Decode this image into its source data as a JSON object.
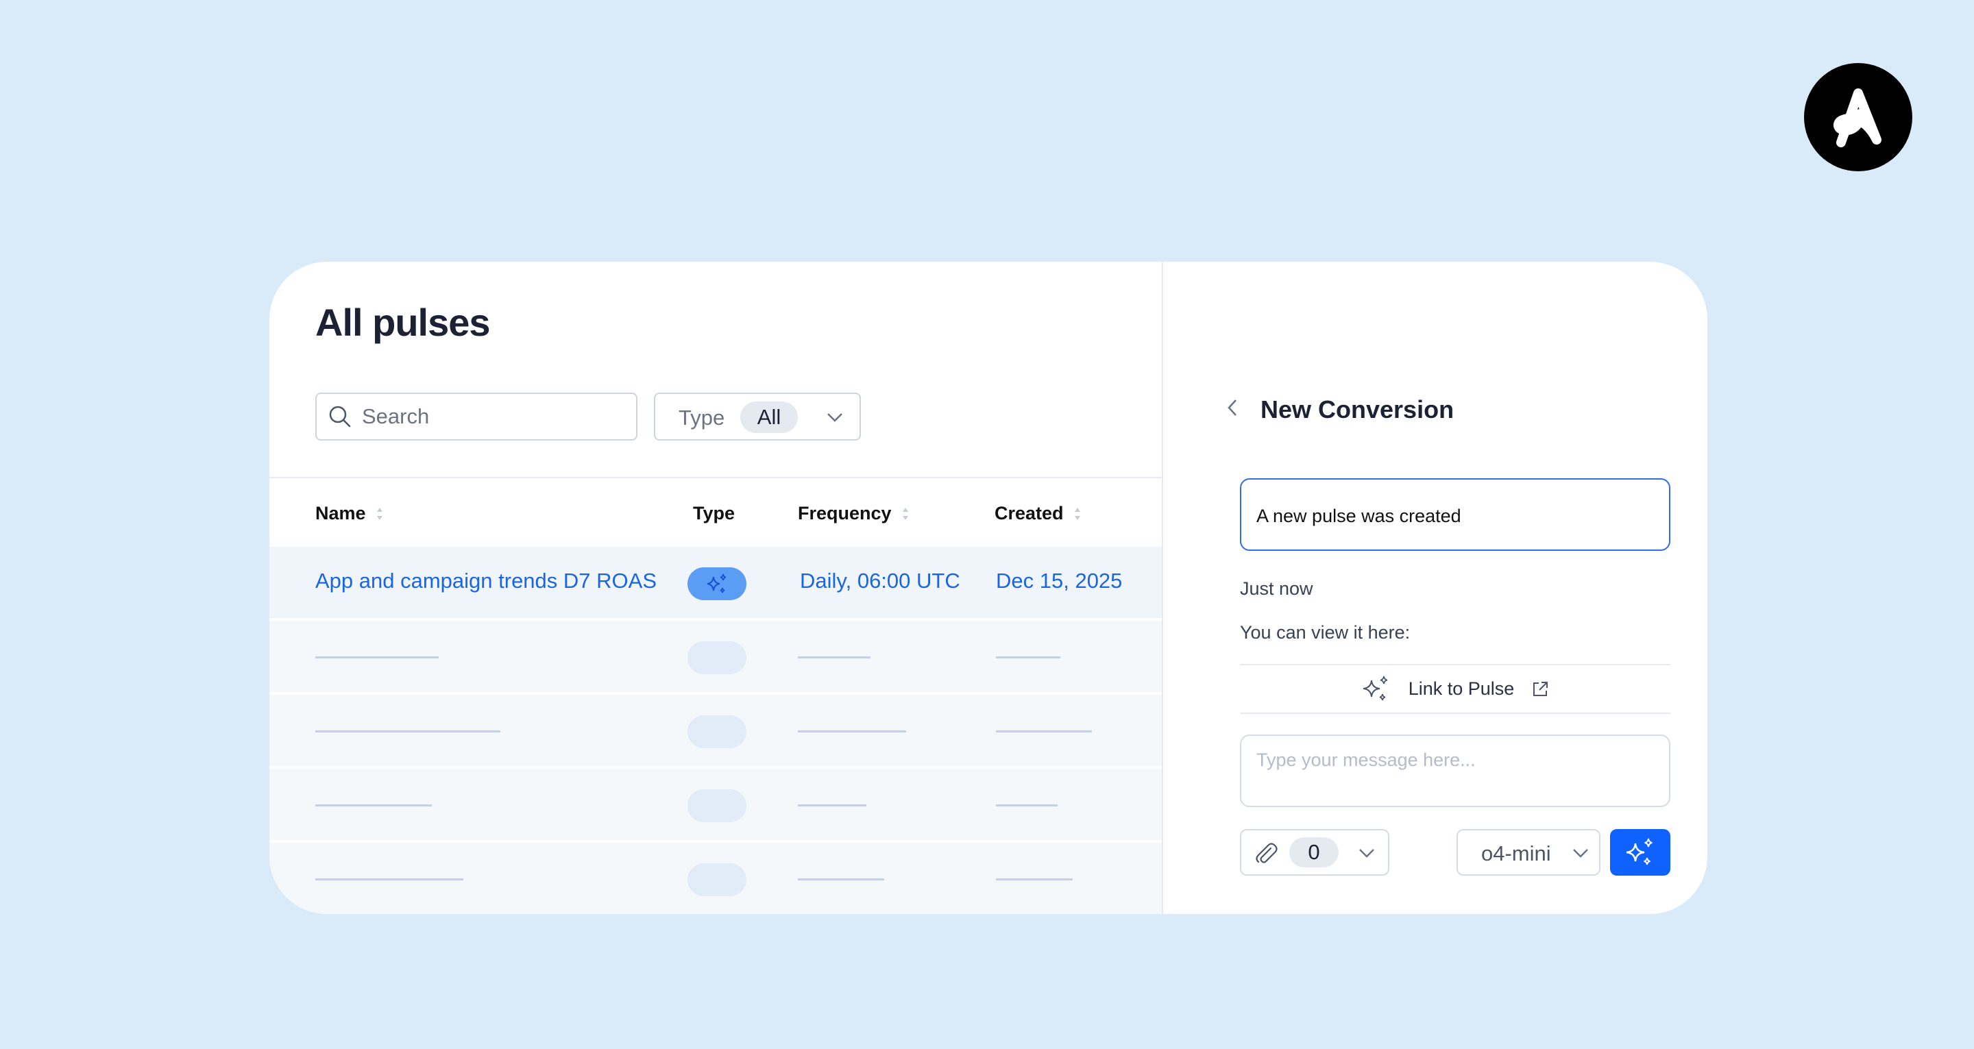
{
  "brand": {
    "logo_icon": "adjust-logo-icon"
  },
  "pulses": {
    "title": "All pulses",
    "search": {
      "placeholder": "Search",
      "value": ""
    },
    "type_filter": {
      "label": "Type",
      "value": "All"
    },
    "columns": {
      "name": "Name",
      "type": "Type",
      "frequency": "Frequency",
      "created": "Created"
    },
    "rows": [
      {
        "name": "App and campaign trends D7 ROAS",
        "type_icon": "sparkles-icon",
        "frequency": "Daily, 06:00 UTC",
        "created": "Dec 15, 2025"
      }
    ]
  },
  "chat": {
    "title": "New Conversion",
    "message": "A new pulse was created",
    "time": "Just now",
    "view_text": "You can view it here:",
    "link_label": "Link to Pulse",
    "compose_placeholder": "Type your message here...",
    "attachments_count": "0",
    "model": "o4-mini"
  },
  "colors": {
    "accent": "#0f62fe",
    "link": "#1a66e0",
    "background": "#d9eaf8"
  }
}
